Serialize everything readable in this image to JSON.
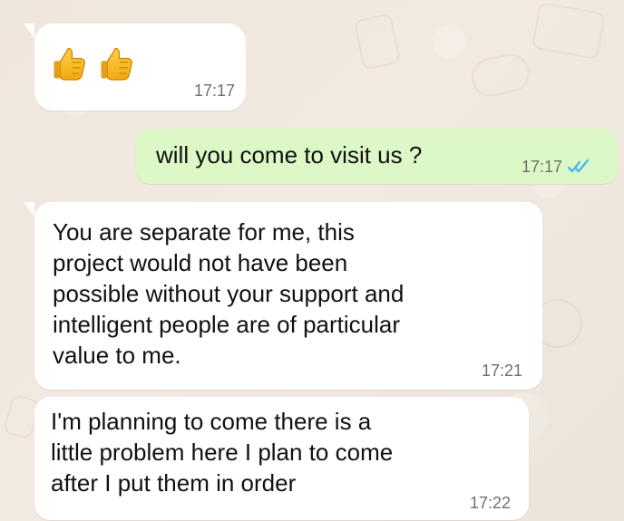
{
  "chat": {
    "messages": [
      {
        "direction": "incoming",
        "content_type": "emoji",
        "emoji": [
          "thumbs-up",
          "thumbs-up"
        ],
        "time": "17:17"
      },
      {
        "direction": "outgoing",
        "content_type": "text",
        "text": "will you come to visit us ?",
        "time": "17:17",
        "status": "read"
      },
      {
        "direction": "incoming",
        "content_type": "text",
        "text": "You are separate for me, this\nproject would not have been\npossible without your support and\nintelligent people are of particular\nvalue to me.",
        "time": "17:21"
      },
      {
        "direction": "incoming",
        "content_type": "text",
        "text": "I'm planning to come there is a\nlittle problem here I plan to come\nafter I put them in order",
        "time": "17:22"
      }
    ]
  },
  "icons": {
    "thumbs_up": "thumbs-up-icon",
    "read_receipt": "double-check-icon"
  },
  "colors": {
    "incoming_bubble": "#ffffff",
    "outgoing_bubble": "#dcf8c6",
    "background": "#efe7de",
    "read_tick": "#4fb6ec",
    "timestamp": "#6f6f6f"
  }
}
